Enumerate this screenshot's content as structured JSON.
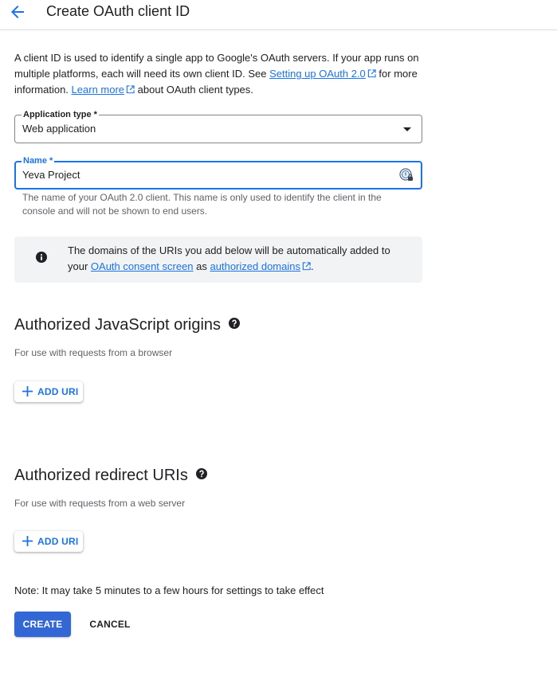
{
  "header": {
    "title": "Create OAuth client ID"
  },
  "intro": {
    "text1": "A client ID is used to identify a single app to Google's OAuth servers. If your app runs on multiple platforms, each will need its own client ID. See ",
    "link1": "Setting up OAuth 2.0",
    "text2": " for more information. ",
    "link2": "Learn more",
    "text3": " about OAuth client types."
  },
  "application_type": {
    "label": "Application type *",
    "value": "Web application"
  },
  "name_field": {
    "label": "Name *",
    "value": "Yeva Project",
    "hint": "The name of your OAuth 2.0 client. This name is only used to identify the client in the console and will not be shown to end users."
  },
  "info_box": {
    "text1": "The domains of the URIs you add below will be automatically added to your ",
    "link1": "OAuth consent screen",
    "text2": " as ",
    "link2": "authorized domains",
    "text3": "."
  },
  "js_origins": {
    "title": "Authorized JavaScript origins",
    "subtitle": "For use with requests from a browser",
    "add_label": "ADD URI"
  },
  "redirect_uris": {
    "title": "Authorized redirect URIs",
    "subtitle": "For use with requests from a web server",
    "add_label": "ADD URI"
  },
  "note": "Note: It may take 5 minutes to a few hours for settings to take effect",
  "actions": {
    "create": "CREATE",
    "cancel": "CANCEL"
  },
  "colors": {
    "accent": "#1a73e8",
    "primary_button": "#3367d6",
    "info_bg": "#f1f3f4"
  },
  "icons": {
    "back": "arrow-left-icon",
    "external": "external-link-icon",
    "dropdown": "dropdown-arrow-icon",
    "password_manager": "password-manager-icon",
    "info": "info-icon",
    "help": "help-icon",
    "plus": "plus-icon"
  }
}
